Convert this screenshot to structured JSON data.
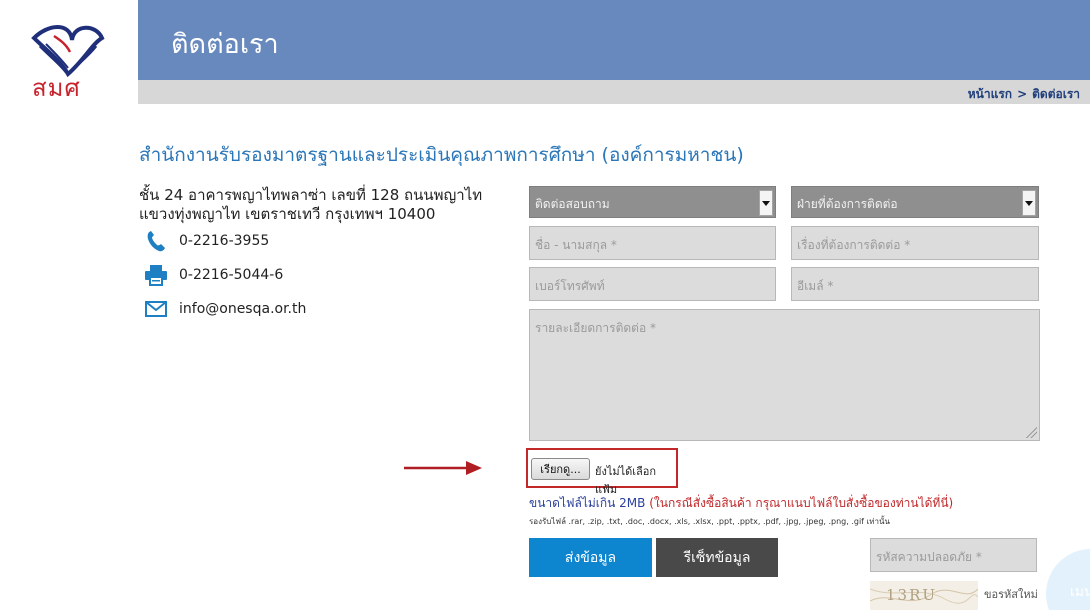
{
  "logo": {
    "text": "สมศ",
    "mark_colors": {
      "blue": "#1f2f7a",
      "red": "#c8232c"
    }
  },
  "header": {
    "title": "ติดต่อเรา",
    "background": "#6889bd"
  },
  "breadcrumb": {
    "home": "หน้าแรก",
    "separator": ">",
    "current": "ติดต่อเรา"
  },
  "org": {
    "name": "สำนักงานรับรองมาตรฐานและประเมินคุณภาพการศึกษา (องค์การมหาชน)",
    "address_line1": "ชั้น 24 อาคารพญาไทพลาซ่า เลขที่ 128 ถนนพญาไท",
    "address_line2": "แขวงทุ่งพญาไท เขตราชเทวี กรุงเทพฯ 10400",
    "phone": "0-2216-3955",
    "fax": "0-2216-5044-6",
    "email": "info@onesqa.or.th",
    "icons": {
      "phone": "phone-icon",
      "fax": "printer-icon",
      "email": "envelope-icon"
    },
    "icon_color": "#1e7fc3"
  },
  "form": {
    "topic_select": {
      "selected": "ติดต่อสอบถาม"
    },
    "department_select": {
      "selected": "ฝ่ายที่ต้องการติดต่อ"
    },
    "name_placeholder": "ชื่อ - นามสกุล *",
    "subject_placeholder": "เรื่องที่ต้องการติดต่อ *",
    "phone_placeholder": "เบอร์โทรศัพท์",
    "email_placeholder": "อีเมล์ *",
    "details_placeholder": "รายละเอียดการติดต่อ *",
    "file_button": "เรียกดู...",
    "file_status": "ยังไม่ได้เลือกแฟ้ม",
    "size_note": "ขนาดไฟล์ไม่เกิน 2MB",
    "size_note_red": "(ในกรณีสั่งซื้อสินค้า กรุณาแนบไฟล์ใบสั่งซื้อของท่านได้ที่นี่)",
    "file_types_note": "รองรับไฟล์ .rar, .zip, .txt, .doc, .docx, .xls, .xlsx, .ppt, .pptx, .pdf, .jpg, .jpeg, .png, .gif เท่านั้น",
    "submit_label": "ส่งข้อมูล",
    "reset_label": "รีเซ็ทข้อมูล",
    "captcha_placeholder": "รหัสความปลอดภัย *",
    "captcha_text": "13RU",
    "refresh_captcha": "ขอรหัสใหม่"
  },
  "side_widget": {
    "label": "เมน"
  },
  "colors": {
    "accent_blue": "#0d86cf",
    "reset_dark": "#494949",
    "highlight_red": "#c0282a",
    "title_blue": "#2a76b8"
  }
}
